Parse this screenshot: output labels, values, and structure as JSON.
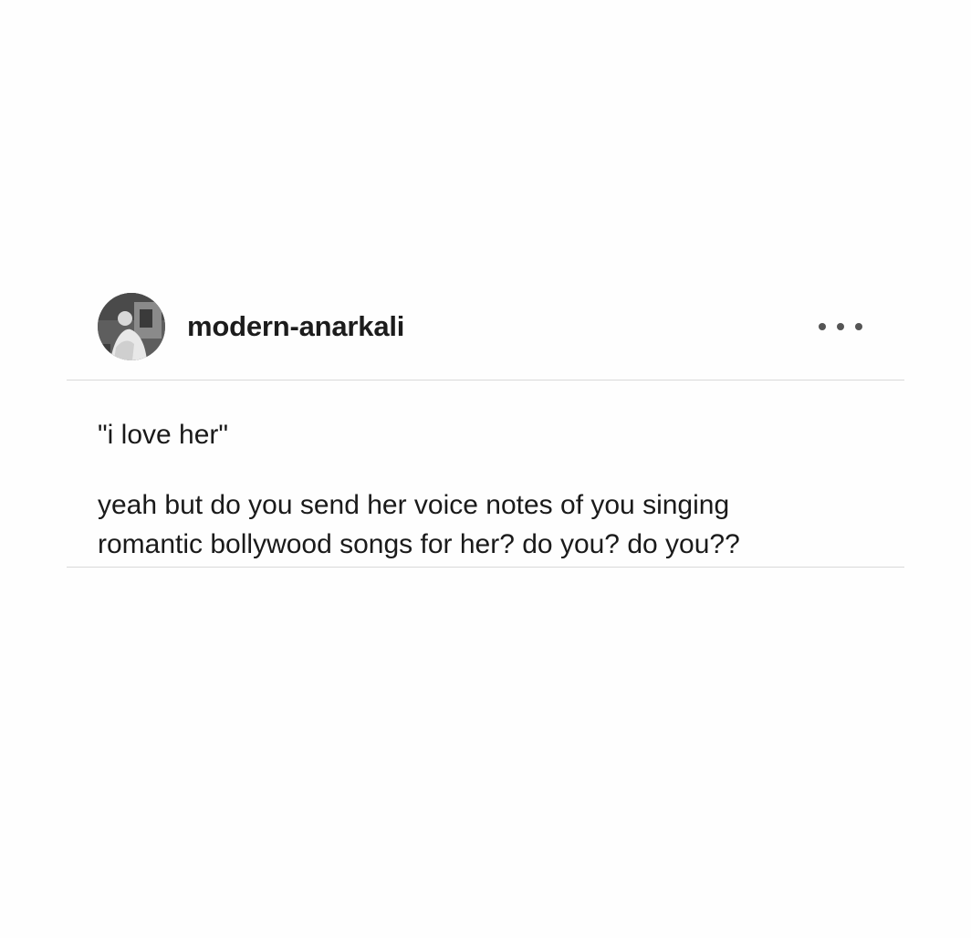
{
  "post": {
    "author": {
      "username": "modern-anarkali",
      "avatar_icon": "user-avatar-photo"
    },
    "menu_icon": "more-options-icon",
    "content": {
      "quote": "\"i love her\"",
      "lines": [
        "yeah but do you send her voice notes of you singing",
        "romantic bollywood songs for her? do you? do you??"
      ]
    }
  },
  "colors": {
    "background": "#fefefe",
    "text": "#1a1a1a",
    "divider": "#d9d9d9",
    "menu_dots": "#555555"
  }
}
